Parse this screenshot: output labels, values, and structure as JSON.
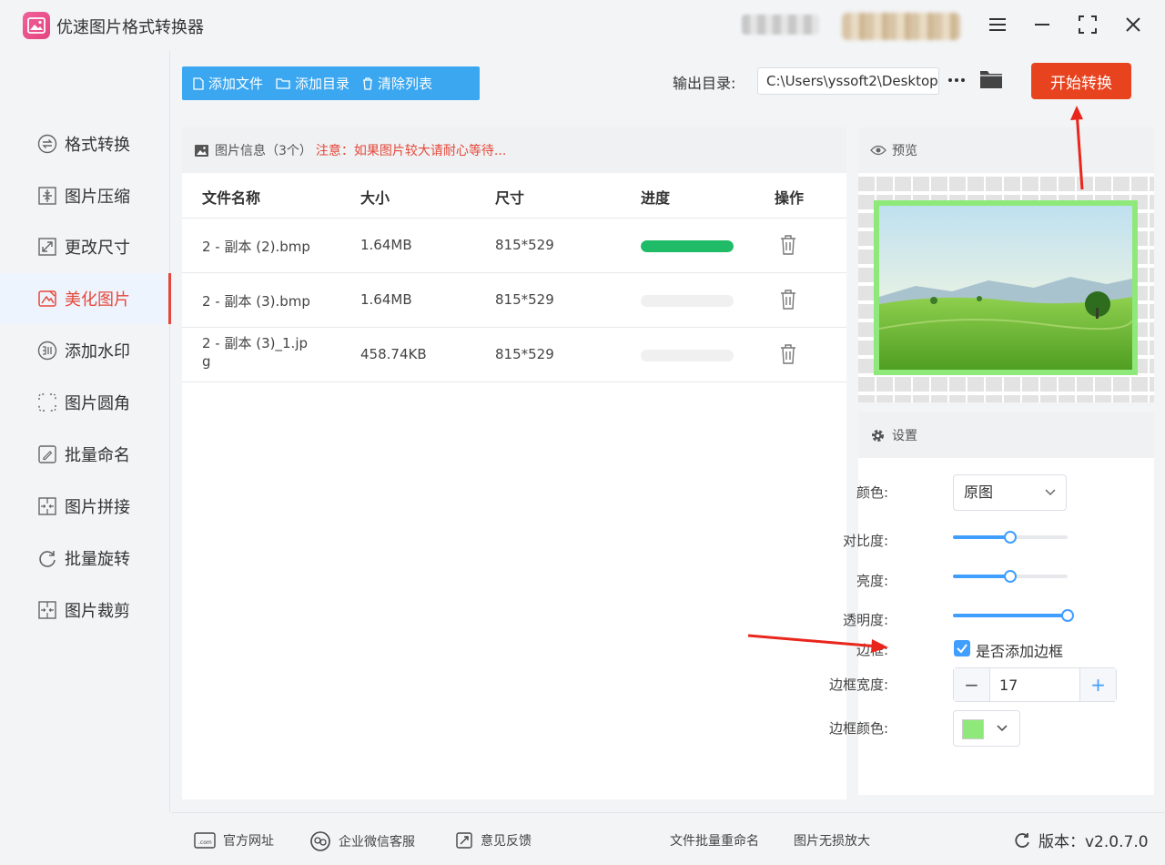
{
  "app": {
    "title": "优速图片格式转换器"
  },
  "sidebar": {
    "items": [
      {
        "label": "格式转换",
        "icon": "format-convert-icon"
      },
      {
        "label": "图片压缩",
        "icon": "compress-icon"
      },
      {
        "label": "更改尺寸",
        "icon": "resize-icon"
      },
      {
        "label": "美化图片",
        "icon": "beautify-icon",
        "active": true
      },
      {
        "label": "添加水印",
        "icon": "watermark-icon"
      },
      {
        "label": "图片圆角",
        "icon": "round-corner-icon"
      },
      {
        "label": "批量命名",
        "icon": "rename-icon"
      },
      {
        "label": "图片拼接",
        "icon": "stitch-icon"
      },
      {
        "label": "批量旋转",
        "icon": "rotate-icon"
      },
      {
        "label": "图片裁剪",
        "icon": "crop-icon"
      }
    ]
  },
  "toolbar": {
    "add_file": "添加文件",
    "add_dir": "添加目录",
    "clear_list": "清除列表",
    "output_label": "输出目录:",
    "output_path": "C:\\Users\\yssoft2\\Desktop",
    "start": "开始转换"
  },
  "file_panel": {
    "title": "图片信息（3个）",
    "notice": "注意：如果图片较大请耐心等待...",
    "columns": [
      "文件名称",
      "大小",
      "尺寸",
      "进度",
      "操作"
    ],
    "rows": [
      {
        "name": "2 - 副本 (2).bmp",
        "size": "1.64MB",
        "dims": "815*529",
        "progress": 1.0
      },
      {
        "name": "2 - 副本 (3).bmp",
        "size": "1.64MB",
        "dims": "815*529",
        "progress": 0.0
      },
      {
        "name_line1": "2 - 副本 (3)_1.jp",
        "name_line2": "g",
        "size": "458.74KB",
        "dims": "815*529",
        "progress": 0.0
      }
    ]
  },
  "preview": {
    "title": "预览",
    "border_color": "#8fe97a"
  },
  "settings": {
    "title": "设置",
    "color_label": "颜色:",
    "color_value": "原图",
    "contrast_label": "对比度:",
    "contrast": 0.5,
    "brightness_label": "亮度:",
    "brightness": 0.5,
    "opacity_label": "透明度:",
    "opacity": 1.0,
    "border_label": "边框:",
    "border_checkbox": "是否添加边框",
    "border_width_label": "边框宽度:",
    "border_width": "17",
    "border_color_label": "边框颜色:",
    "border_color": "#8fe97a"
  },
  "footer": {
    "website": "官方网址",
    "wechat": "企业微信客服",
    "feedback": "意见反馈",
    "batch_rename": "文件批量重命名",
    "lossless": "图片无损放大",
    "version": "版本：v2.0.7.0"
  },
  "colors": {
    "accent": "#e5483a",
    "primary": "#409eff",
    "toolbar": "#3aa7f0",
    "progress": "#1fbb66",
    "start_button": "#e8431f"
  }
}
